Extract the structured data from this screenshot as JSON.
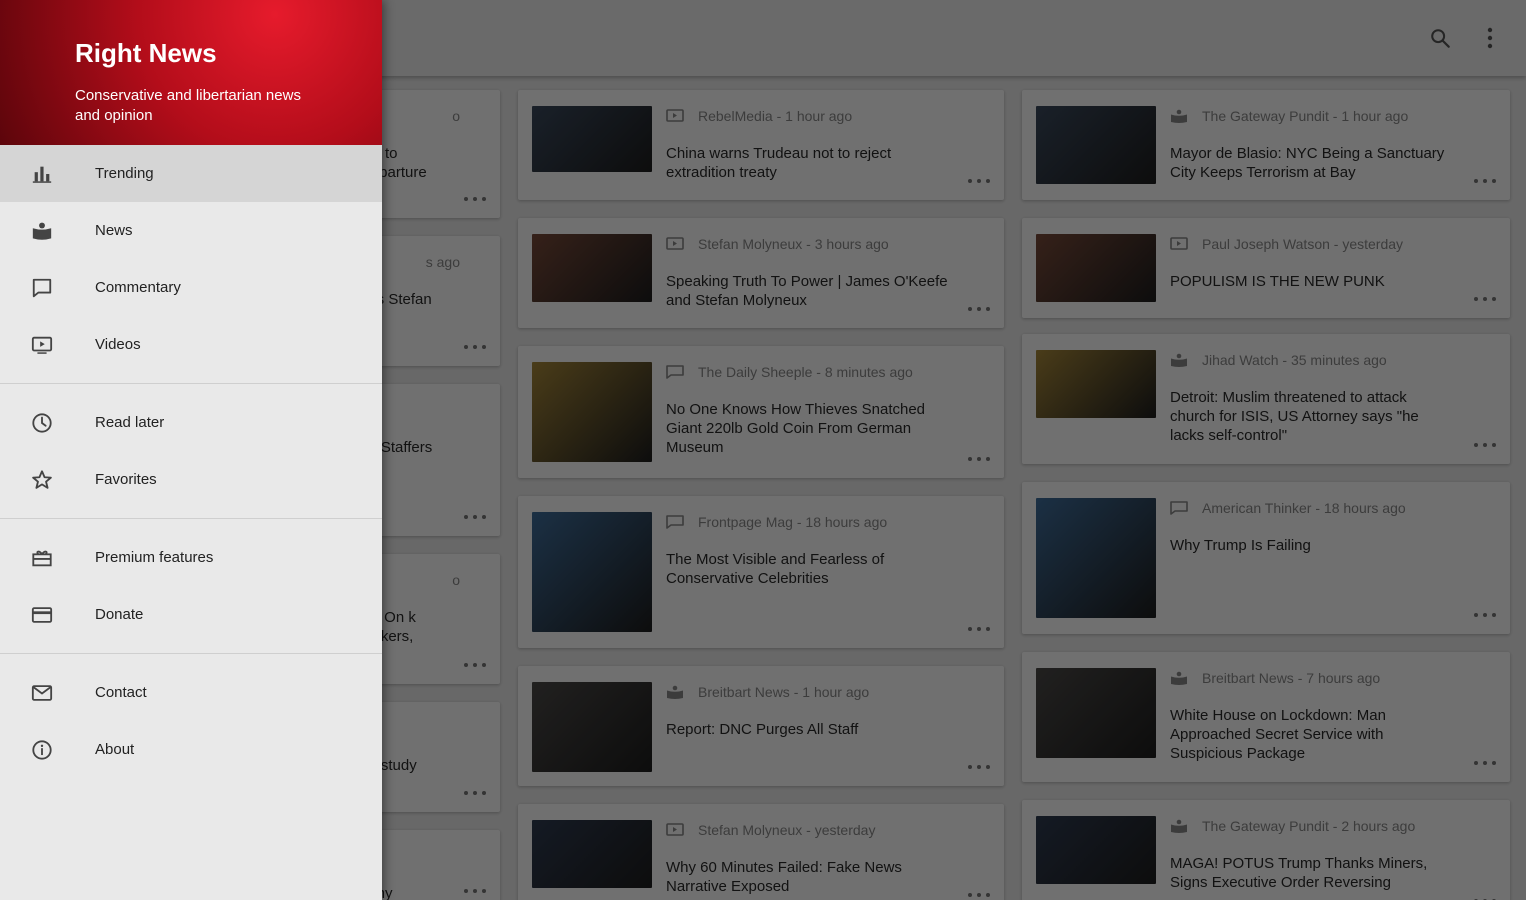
{
  "drawer": {
    "title": "Right News",
    "subtitle": "Conservative and libertarian news and opinion",
    "groups": [
      [
        {
          "label": "Trending",
          "icon": "bar-chart-icon",
          "active": true
        },
        {
          "label": "News",
          "icon": "news-icon"
        },
        {
          "label": "Commentary",
          "icon": "comment-icon"
        },
        {
          "label": "Videos",
          "icon": "video-icon"
        }
      ],
      [
        {
          "label": "Read later",
          "icon": "clock-icon"
        },
        {
          "label": "Favorites",
          "icon": "star-icon"
        }
      ],
      [
        {
          "label": "Premium features",
          "icon": "gift-icon"
        },
        {
          "label": "Donate",
          "icon": "credit-card-icon"
        }
      ],
      [
        {
          "label": "Contact",
          "icon": "mail-icon"
        },
        {
          "label": "About",
          "icon": "info-icon"
        }
      ]
    ]
  },
  "appbar": {
    "search_icon": "search-icon",
    "menu_icon": "more-vert-icon"
  },
  "colors": {
    "brand_red": "#d0101e",
    "scrim": "#000000"
  },
  "articles_left_partial": [
    {
      "meta": "o",
      "headline": "tler to Departure"
    },
    {
      "meta": "s ago",
      "headline": "eps Stefan"
    },
    {
      "meta": "",
      "headline": "All Staffers"
    },
    {
      "meta": "o",
      "headline": "ets On k Pickers,"
    },
    {
      "meta": "",
      "headline": "ed study"
    },
    {
      "meta": "",
      "headline": "mmy"
    }
  ],
  "articles_middle": [
    {
      "source": "RebelMedia",
      "time": "1 hour ago",
      "headline": "China warns Trudeau not to reject extradition treaty",
      "type": "video"
    },
    {
      "source": "Stefan Molyneux",
      "time": "3 hours ago",
      "headline": "Speaking Truth To Power | James O'Keefe and Stefan Molyneux",
      "type": "video"
    },
    {
      "source": "The Daily Sheeple",
      "time": "8 minutes ago",
      "headline": "No One Knows How Thieves Snatched Giant 220lb Gold Coin From German Museum",
      "type": "comment"
    },
    {
      "source": "Frontpage Mag",
      "time": "18 hours ago",
      "headline": "The Most Visible and Fearless of Conservative Celebrities",
      "type": "comment"
    },
    {
      "source": "Breitbart News",
      "time": "1 hour ago",
      "headline": "Report: DNC Purges All Staff",
      "type": "news"
    },
    {
      "source": "Stefan Molyneux",
      "time": "yesterday",
      "headline": "Why 60 Minutes Failed: Fake News Narrative Exposed",
      "type": "video"
    }
  ],
  "articles_right": [
    {
      "source": "The Gateway Pundit",
      "time": "1 hour ago",
      "headline": "Mayor de Blasio: NYC Being a Sanctuary City Keeps Terrorism at Bay",
      "type": "news"
    },
    {
      "source": "Paul Joseph Watson",
      "time": "yesterday",
      "headline": "POPULISM IS THE NEW PUNK",
      "type": "video"
    },
    {
      "source": "Jihad Watch",
      "time": "35 minutes ago",
      "headline": "Detroit: Muslim threatened to attack church for ISIS, US Attorney says \"he lacks self-control\"",
      "type": "news"
    },
    {
      "source": "American Thinker",
      "time": "18 hours ago",
      "headline": "Why Trump Is Failing",
      "type": "comment"
    },
    {
      "source": "Breitbart News",
      "time": "7 hours ago",
      "headline": "White House on Lockdown: Man Approached Secret Service with Suspicious Package",
      "type": "news"
    },
    {
      "source": "The Gateway Pundit",
      "time": "2 hours ago",
      "headline": "MAGA! POTUS Trump Thanks Miners, Signs Executive Order Reversing",
      "type": "news"
    }
  ]
}
